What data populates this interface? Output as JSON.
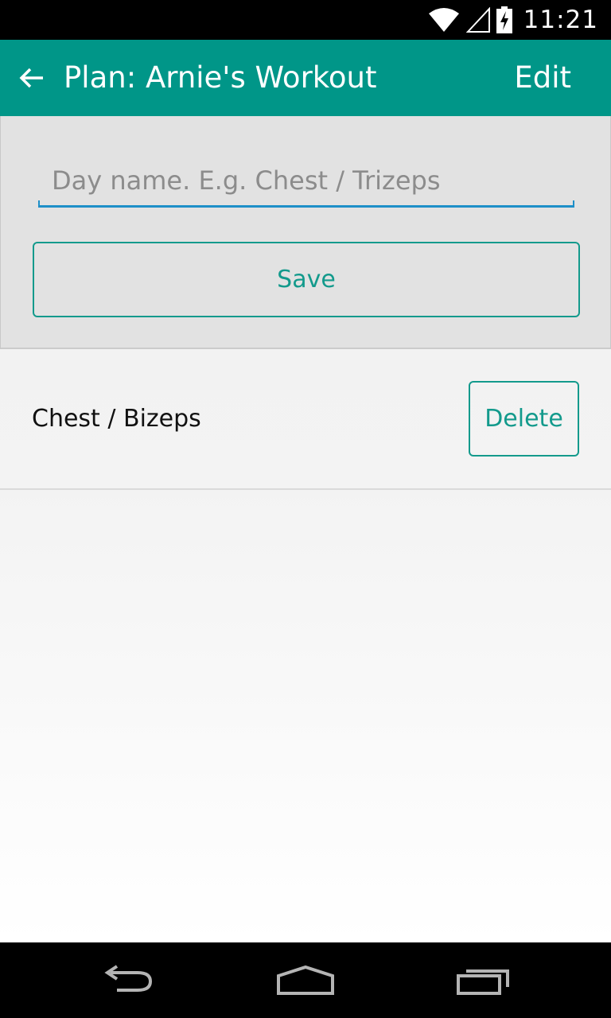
{
  "status_bar": {
    "time": "11:21",
    "icons": [
      "wifi-icon",
      "signal-icon",
      "battery-charging-icon"
    ]
  },
  "action_bar": {
    "back_icon": "arrow-left-icon",
    "title": "Plan: Arnie's Workout",
    "edit_label": "Edit"
  },
  "form": {
    "day_name_value": "",
    "day_name_placeholder": "Day name. E.g. Chest / Trizeps",
    "save_label": "Save"
  },
  "days": [
    {
      "name": "Chest / Bizeps",
      "delete_label": "Delete"
    }
  ],
  "nav_bar": {
    "buttons": [
      "back-nav-icon",
      "home-nav-icon",
      "recents-nav-icon"
    ]
  },
  "colors": {
    "primary": "#009688",
    "accent_text": "#139a8c",
    "input_underline": "#1e8fc8"
  }
}
